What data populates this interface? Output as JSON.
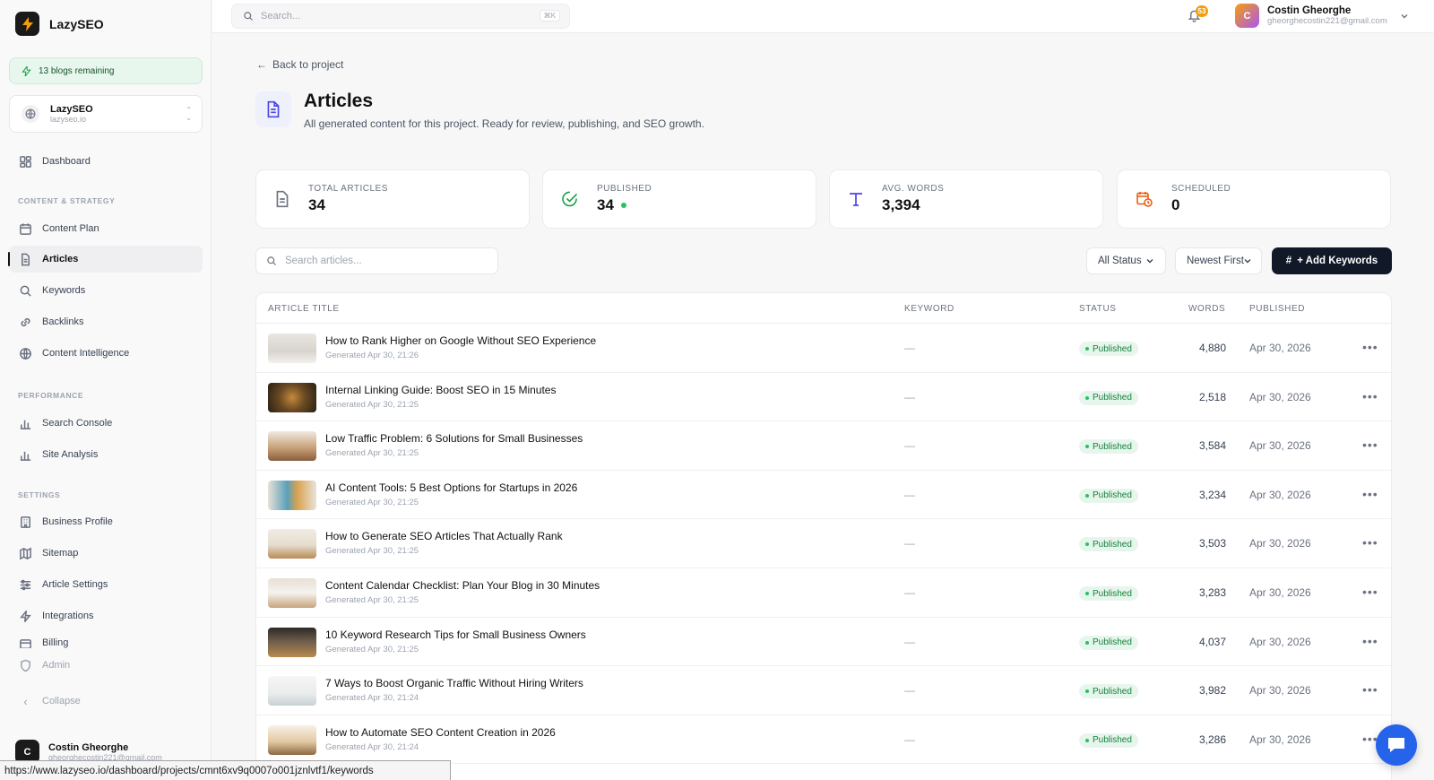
{
  "sidebar": {
    "brand": "LazySEO",
    "blogs_remaining": "13 blogs remaining",
    "project": {
      "name": "LazySEO",
      "url": "lazyseo.io"
    },
    "dashboard": "Dashboard",
    "section_content": "CONTENT & STRATEGY",
    "content_plan": "Content Plan",
    "articles": "Articles",
    "keywords": "Keywords",
    "backlinks": "Backlinks",
    "content_intelligence": "Content Intelligence",
    "section_performance": "PERFORMANCE",
    "search_console": "Search Console",
    "site_analysis": "Site Analysis",
    "section_settings": "SETTINGS",
    "business_profile": "Business Profile",
    "sitemap": "Sitemap",
    "article_settings": "Article Settings",
    "integrations": "Integrations",
    "billing": "Billing",
    "admin": "Admin",
    "collapse": "Collapse",
    "user": {
      "initial": "C",
      "name": "Costin Gheorghe",
      "email": "gheorghecostin221@gmail.com"
    }
  },
  "topbar": {
    "search_placeholder": "Search...",
    "shortcut": "⌘K",
    "notifications": "53",
    "user": {
      "initial": "C",
      "name": "Costin Gheorghe",
      "email": "gheorghecostin221@gmail.com"
    }
  },
  "page": {
    "back": "Back to project",
    "title": "Articles",
    "subtitle": "All generated content for this project. Ready for review, publishing, and SEO growth."
  },
  "stats": [
    {
      "label": "TOTAL ARTICLES",
      "value": "34"
    },
    {
      "label": "PUBLISHED",
      "value": "34"
    },
    {
      "label": "AVG. WORDS",
      "value": "3,394"
    },
    {
      "label": "SCHEDULED",
      "value": "0"
    }
  ],
  "controls": {
    "search_placeholder": "Search articles...",
    "status_filter": "All Status",
    "sort": "Newest First",
    "add_keywords": "+ Add Keywords"
  },
  "table": {
    "headers": [
      "ARTICLE TITLE",
      "KEYWORD",
      "STATUS",
      "WORDS",
      "PUBLISHED"
    ],
    "rows": [
      {
        "title": "How to Rank Higher on Google Without SEO Experience",
        "generated": "Generated Apr 30, 21:26",
        "keyword": "—",
        "status": "Published",
        "words": "4,880",
        "published": "Apr 30, 2026"
      },
      {
        "title": "Internal Linking Guide: Boost SEO in 15 Minutes",
        "generated": "Generated Apr 30, 21:25",
        "keyword": "—",
        "status": "Published",
        "words": "2,518",
        "published": "Apr 30, 2026"
      },
      {
        "title": "Low Traffic Problem: 6 Solutions for Small Businesses",
        "generated": "Generated Apr 30, 21:25",
        "keyword": "—",
        "status": "Published",
        "words": "3,584",
        "published": "Apr 30, 2026"
      },
      {
        "title": "AI Content Tools: 5 Best Options for Startups in 2026",
        "generated": "Generated Apr 30, 21:25",
        "keyword": "—",
        "status": "Published",
        "words": "3,234",
        "published": "Apr 30, 2026"
      },
      {
        "title": "How to Generate SEO Articles That Actually Rank",
        "generated": "Generated Apr 30, 21:25",
        "keyword": "—",
        "status": "Published",
        "words": "3,503",
        "published": "Apr 30, 2026"
      },
      {
        "title": "Content Calendar Checklist: Plan Your Blog in 30 Minutes",
        "generated": "Generated Apr 30, 21:25",
        "keyword": "—",
        "status": "Published",
        "words": "3,283",
        "published": "Apr 30, 2026"
      },
      {
        "title": "10 Keyword Research Tips for Small Business Owners",
        "generated": "Generated Apr 30, 21:25",
        "keyword": "—",
        "status": "Published",
        "words": "4,037",
        "published": "Apr 30, 2026"
      },
      {
        "title": "7 Ways to Boost Organic Traffic Without Hiring Writers",
        "generated": "Generated Apr 30, 21:24",
        "keyword": "—",
        "status": "Published",
        "words": "3,982",
        "published": "Apr 30, 2026"
      },
      {
        "title": "How to Automate SEO Content Creation in 2026",
        "generated": "Generated Apr 30, 21:24",
        "keyword": "—",
        "status": "Published",
        "words": "3,286",
        "published": "Apr 30, 2026"
      }
    ]
  },
  "status_url": "https://www.lazyseo.io/dashboard/projects/cmnt6xv9q0007o001jznlvtf1/keywords",
  "colors": {
    "accent": "#111827",
    "published_bg": "#e7f6ec",
    "published_text": "#15803d",
    "chat": "#2563eb"
  }
}
